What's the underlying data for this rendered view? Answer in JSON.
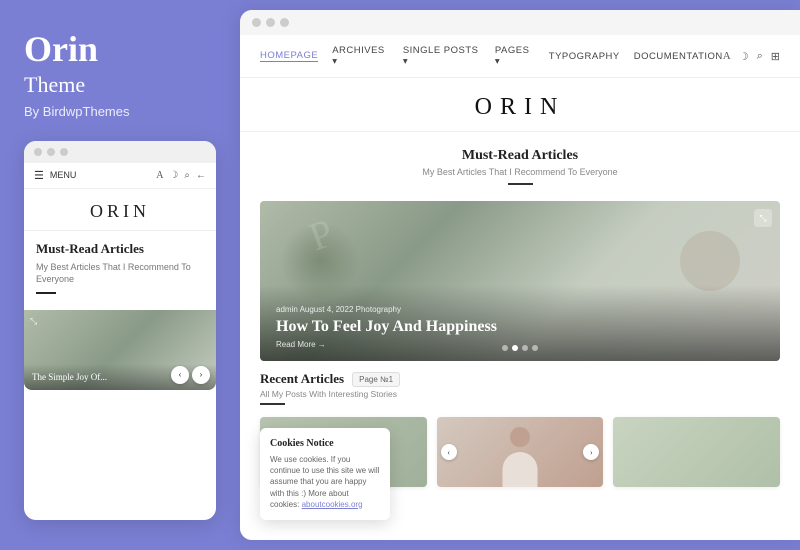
{
  "left": {
    "title": "Orin",
    "subtitle": "Theme",
    "byline": "By BirdwpThemes",
    "mini_browser": {
      "nav_menu": "MENU",
      "nav_icons": [
        "A",
        "☽",
        "🔍",
        "←"
      ],
      "logo": "ORIN",
      "section_title": "Must-Read Articles",
      "section_sub": "My Best Articles That I Recommend To Everyone",
      "article_title": "The Simple Joy Of..."
    }
  },
  "right": {
    "browser": {
      "nav_items": [
        {
          "label": "HOMEPAGE",
          "active": true
        },
        {
          "label": "ARCHIVES ▾",
          "active": false
        },
        {
          "label": "SINGLE POSTS ▾",
          "active": false
        },
        {
          "label": "PAGES ▾",
          "active": false
        },
        {
          "label": "TYPOGRAPHY",
          "active": false
        },
        {
          "label": "DOCUMENTATION",
          "active": false
        }
      ],
      "nav_icons": [
        "A",
        "☽",
        "🔍",
        "⊞"
      ],
      "site_logo": "ORIN",
      "hero": {
        "title": "Must-Read Articles",
        "subtitle": "My Best Articles That I Recommend To Everyone"
      },
      "featured": {
        "meta": "admin   August 4, 2022   Photography",
        "title": "How To Feel Joy And Happiness",
        "read_more": "Read More →"
      },
      "dots": [
        false,
        true,
        false,
        false
      ],
      "recent": {
        "title": "Recent Articles",
        "subtitle": "All My Posts With Interesting Stories",
        "page_badge": "Page №1"
      },
      "cookies": {
        "title": "Cookies Notice",
        "text": "We use cookies. If you continue to use this site we will assume that you are happy with this :) More about cookies:",
        "link": "aboutcookies.org"
      }
    }
  }
}
